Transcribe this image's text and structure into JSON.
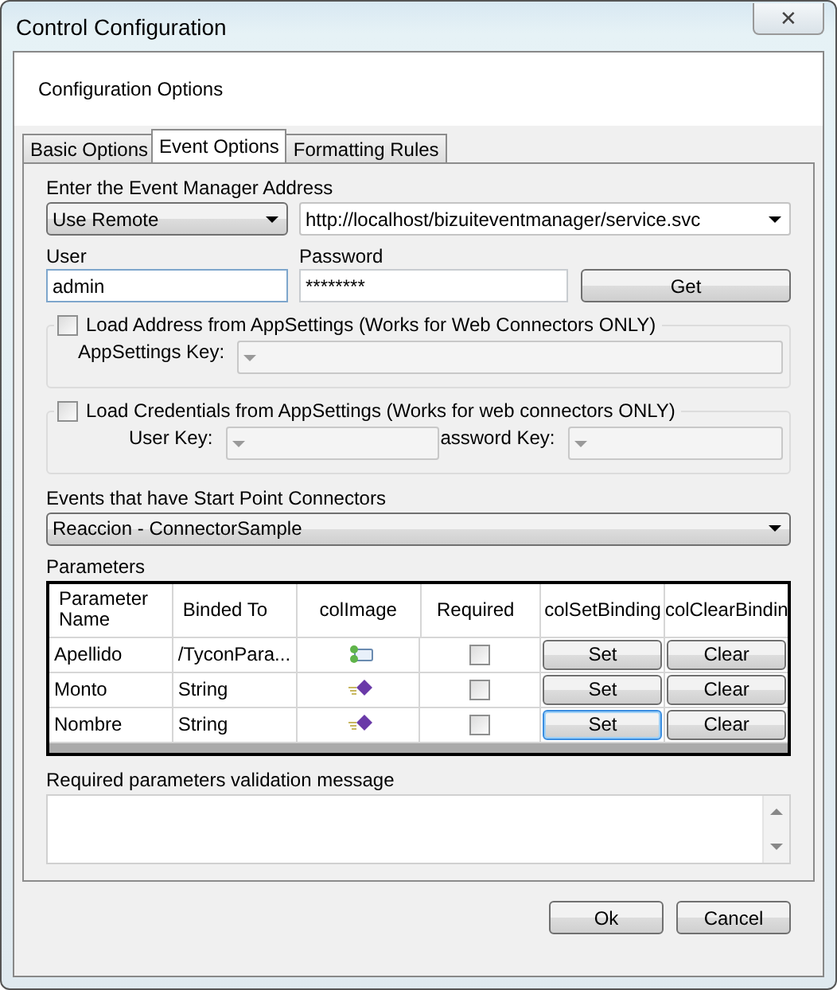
{
  "window": {
    "title": "Control Configuration",
    "close": "✕"
  },
  "header": "Configuration Options",
  "tabs": [
    {
      "label": "Basic Options",
      "selected": false
    },
    {
      "label": "Event Options",
      "selected": true
    },
    {
      "label": "Formatting Rules",
      "selected": false
    }
  ],
  "address": {
    "label": "Enter the Event Manager Address",
    "mode": "Use Remote",
    "url": "http://localhost/bizuiteventmanager/service.svc"
  },
  "user": {
    "label": "User",
    "value": "admin"
  },
  "password": {
    "label": "Password",
    "value": "********"
  },
  "get_button": "Get",
  "load_address": {
    "label": "Load Address from AppSettings (Works for Web Connectors ONLY)",
    "checked": false,
    "key_label": "AppSettings Key:"
  },
  "load_credentials": {
    "label": "Load Credentials from AppSettings (Works for web connectors ONLY)",
    "checked": false,
    "user_key_label": "User Key:",
    "password_key_label": "assword Key:"
  },
  "events": {
    "label": "Events that have Start Point Connectors",
    "value": "Reaccion - ConnectorSample"
  },
  "parameters": {
    "label": "Parameters",
    "columns": [
      "Parameter Name",
      "Binded To",
      "colImage",
      "Required",
      "colSetBinding",
      "colClearBindin"
    ],
    "rows": [
      {
        "name": "Apellido",
        "binded": "/TyconPara...",
        "kind": "complex",
        "required": false,
        "set": "Set",
        "set_focused": false,
        "clear": "Clear"
      },
      {
        "name": "Monto",
        "binded": "String",
        "kind": "simple",
        "required": false,
        "set": "Set",
        "set_focused": false,
        "clear": "Clear"
      },
      {
        "name": "Nombre",
        "binded": "String",
        "kind": "simple",
        "required": false,
        "set": "Set",
        "set_focused": true,
        "clear": "Clear"
      }
    ]
  },
  "validation": {
    "label": "Required parameters validation message"
  },
  "buttons": [
    "Ok",
    "Cancel"
  ]
}
